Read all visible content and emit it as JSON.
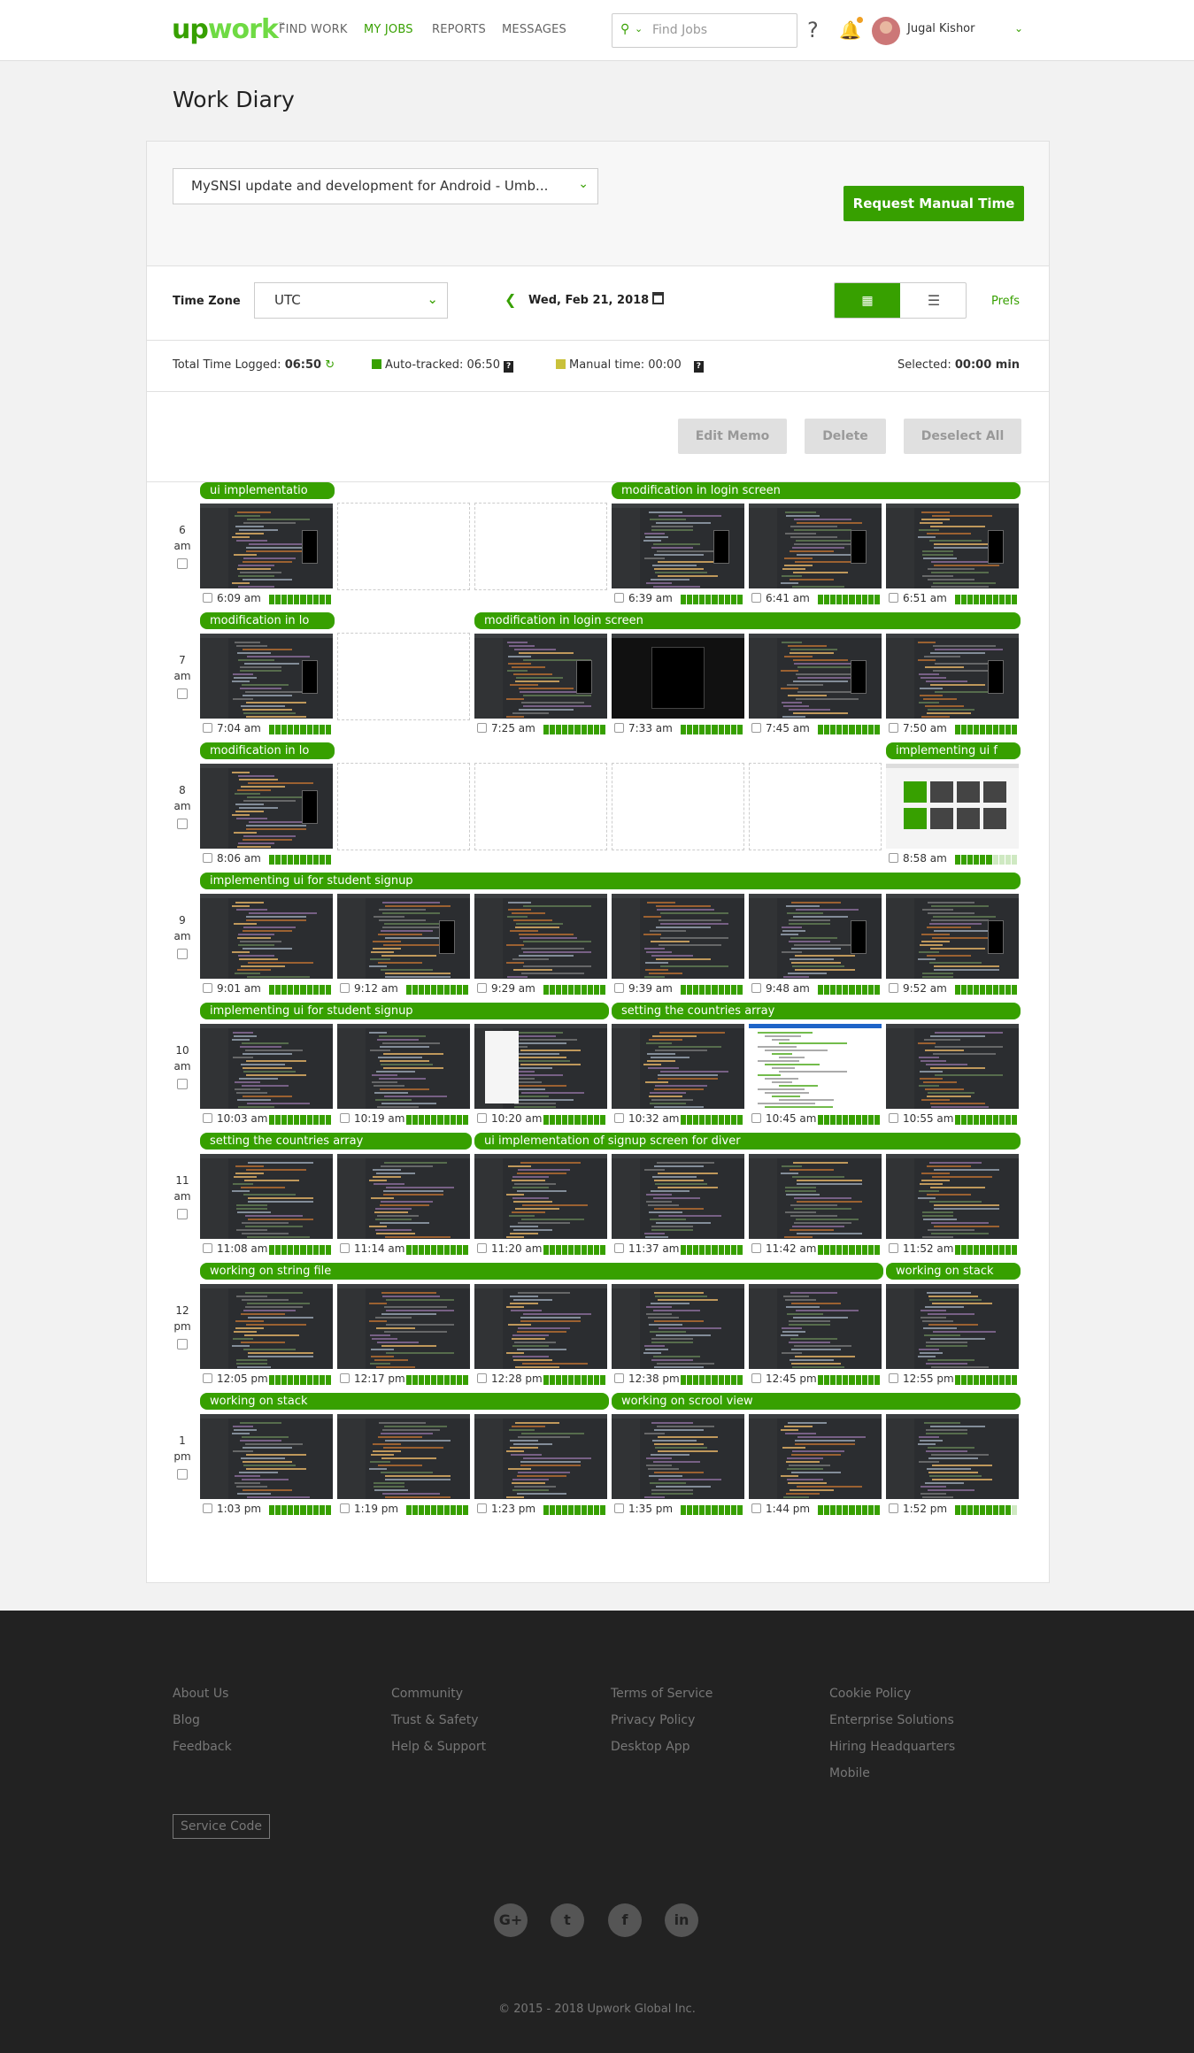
{
  "header": {
    "logo": "upwork",
    "nav": [
      "FIND WORK",
      "MY JOBS",
      "REPORTS",
      "MESSAGES"
    ],
    "active_nav": "MY JOBS",
    "search_placeholder": "Find Jobs",
    "user_name": "Jugal Kishor",
    "icons": [
      "search-icon",
      "chevron-down-icon",
      "help-icon",
      "bell-icon",
      "avatar",
      "user-menu-chevron-icon"
    ]
  },
  "page_title": "Work Diary",
  "contract": {
    "selected": "MySNSI update and development for Android - Umb...",
    "request_button": "Request Manual Time"
  },
  "controls": {
    "timezone_label": "Time Zone",
    "timezone_value": "UTC",
    "date": "Wed, Feb 21, 2018",
    "prefs": "Prefs",
    "view": "grid"
  },
  "summary": {
    "total_label": "Total Time Logged:",
    "total_value": "06:50",
    "auto_label": "Auto-tracked: 06:50",
    "manual_label": "Manual time: 00:00",
    "selected_label": "Selected:",
    "selected_value": "00:00 min",
    "auto_color": "#37a000",
    "manual_color": "#c9c13a"
  },
  "actions": {
    "edit_memo": "Edit Memo",
    "delete": "Delete",
    "deselect_all": "Deselect All"
  },
  "hours": [
    {
      "num": "6",
      "ampm": "am",
      "memos": [
        {
          "text": "ui implementatio",
          "start": 0,
          "span": 1
        },
        {
          "text": "modification in login screen",
          "start": 3,
          "span": 3
        }
      ],
      "slots": [
        {
          "time": "6:09 am",
          "act": 10,
          "kind": "code-phone"
        },
        null,
        null,
        {
          "time": "6:39 am",
          "act": 10,
          "kind": "code-phone"
        },
        {
          "time": "6:41 am",
          "act": 10,
          "kind": "code-phone"
        },
        {
          "time": "6:51 am",
          "act": 10,
          "kind": "code-phone"
        }
      ]
    },
    {
      "num": "7",
      "ampm": "am",
      "memos": [
        {
          "text": "modification in lo",
          "start": 0,
          "span": 1
        },
        {
          "text": "modification in login screen",
          "start": 2,
          "span": 4
        }
      ],
      "slots": [
        {
          "time": "7:04 am",
          "act": 10,
          "kind": "code-phone"
        },
        null,
        {
          "time": "7:25 am",
          "act": 10,
          "kind": "code-phone"
        },
        {
          "time": "7:33 am",
          "act": 10,
          "kind": "dark-dialog"
        },
        {
          "time": "7:45 am",
          "act": 10,
          "kind": "code-phone"
        },
        {
          "time": "7:50 am",
          "act": 10,
          "kind": "code-phone"
        }
      ]
    },
    {
      "num": "8",
      "ampm": "am",
      "memos": [
        {
          "text": "modification in lo",
          "start": 0,
          "span": 1
        },
        {
          "text": "implementing ui f",
          "start": 5,
          "span": 1
        }
      ],
      "slots": [
        {
          "time": "8:06 am",
          "act": 10,
          "kind": "code-phone"
        },
        null,
        null,
        null,
        null,
        {
          "time": "8:58 am",
          "act": 6,
          "kind": "light-grid"
        }
      ]
    },
    {
      "num": "9",
      "ampm": "am",
      "memos": [
        {
          "text": "implementing ui for student signup",
          "start": 0,
          "span": 6
        }
      ],
      "slots": [
        {
          "time": "9:01 am",
          "act": 10,
          "kind": "code"
        },
        {
          "time": "9:12 am",
          "act": 10,
          "kind": "code-phone"
        },
        {
          "time": "9:29 am",
          "act": 10,
          "kind": "code"
        },
        {
          "time": "9:39 am",
          "act": 10,
          "kind": "code"
        },
        {
          "time": "9:48 am",
          "act": 10,
          "kind": "code-phone"
        },
        {
          "time": "9:52 am",
          "act": 10,
          "kind": "code-phone"
        }
      ]
    },
    {
      "num": "10",
      "ampm": "am",
      "memos": [
        {
          "text": "implementing ui for student signup",
          "start": 0,
          "span": 3
        },
        {
          "text": "setting the countries array",
          "start": 3,
          "span": 3
        }
      ],
      "slots": [
        {
          "time": "10:03 am",
          "act": 10,
          "kind": "code"
        },
        {
          "time": "10:19 am",
          "act": 10,
          "kind": "code"
        },
        {
          "time": "10:20 am",
          "act": 10,
          "kind": "code-light"
        },
        {
          "time": "10:32 am",
          "act": 10,
          "kind": "code"
        },
        {
          "time": "10:45 am",
          "act": 10,
          "kind": "white-doc"
        },
        {
          "time": "10:55 am",
          "act": 10,
          "kind": "code"
        }
      ]
    },
    {
      "num": "11",
      "ampm": "am",
      "memos": [
        {
          "text": "setting the countries array",
          "start": 0,
          "span": 2
        },
        {
          "text": "ui implementation of signup screen for diver",
          "start": 2,
          "span": 4
        }
      ],
      "slots": [
        {
          "time": "11:08 am",
          "act": 10,
          "kind": "code"
        },
        {
          "time": "11:14 am",
          "act": 10,
          "kind": "code"
        },
        {
          "time": "11:20 am",
          "act": 10,
          "kind": "code"
        },
        {
          "time": "11:37 am",
          "act": 10,
          "kind": "code"
        },
        {
          "time": "11:42 am",
          "act": 10,
          "kind": "code"
        },
        {
          "time": "11:52 am",
          "act": 10,
          "kind": "code"
        }
      ]
    },
    {
      "num": "12",
      "ampm": "pm",
      "memos": [
        {
          "text": "working on string file",
          "start": 0,
          "span": 5
        },
        {
          "text": "working on stack",
          "start": 5,
          "span": 1
        }
      ],
      "slots": [
        {
          "time": "12:05 pm",
          "act": 10,
          "kind": "code"
        },
        {
          "time": "12:17 pm",
          "act": 10,
          "kind": "code"
        },
        {
          "time": "12:28 pm",
          "act": 10,
          "kind": "code"
        },
        {
          "time": "12:38 pm",
          "act": 10,
          "kind": "code"
        },
        {
          "time": "12:45 pm",
          "act": 10,
          "kind": "code"
        },
        {
          "time": "12:55 pm",
          "act": 10,
          "kind": "code"
        }
      ]
    },
    {
      "num": "1",
      "ampm": "pm",
      "memos": [
        {
          "text": "working on stack",
          "start": 0,
          "span": 3
        },
        {
          "text": "working on scrool view",
          "start": 3,
          "span": 3
        }
      ],
      "slots": [
        {
          "time": "1:03 pm",
          "act": 10,
          "kind": "code"
        },
        {
          "time": "1:19 pm",
          "act": 10,
          "kind": "code"
        },
        {
          "time": "1:23 pm",
          "act": 10,
          "kind": "code"
        },
        {
          "time": "1:35 pm",
          "act": 10,
          "kind": "code"
        },
        {
          "time": "1:44 pm",
          "act": 10,
          "kind": "code"
        },
        {
          "time": "1:52 pm",
          "act": 9,
          "kind": "code"
        }
      ]
    }
  ],
  "footer": {
    "columns": [
      [
        "About Us",
        "Blog",
        "Feedback"
      ],
      [
        "Community",
        "Trust & Safety",
        "Help & Support"
      ],
      [
        "Terms of Service",
        "Privacy Policy",
        "Desktop App"
      ],
      [
        "Cookie Policy",
        "Enterprise Solutions",
        "Hiring Headquarters",
        "Mobile"
      ]
    ],
    "service_code": "Service Code",
    "social": [
      "G+",
      "t",
      "f",
      "in"
    ],
    "social_icons": [
      "google-plus-icon",
      "twitter-icon",
      "facebook-icon",
      "linkedin-icon"
    ],
    "copyright": "© 2015 - 2018 Upwork Global Inc."
  }
}
